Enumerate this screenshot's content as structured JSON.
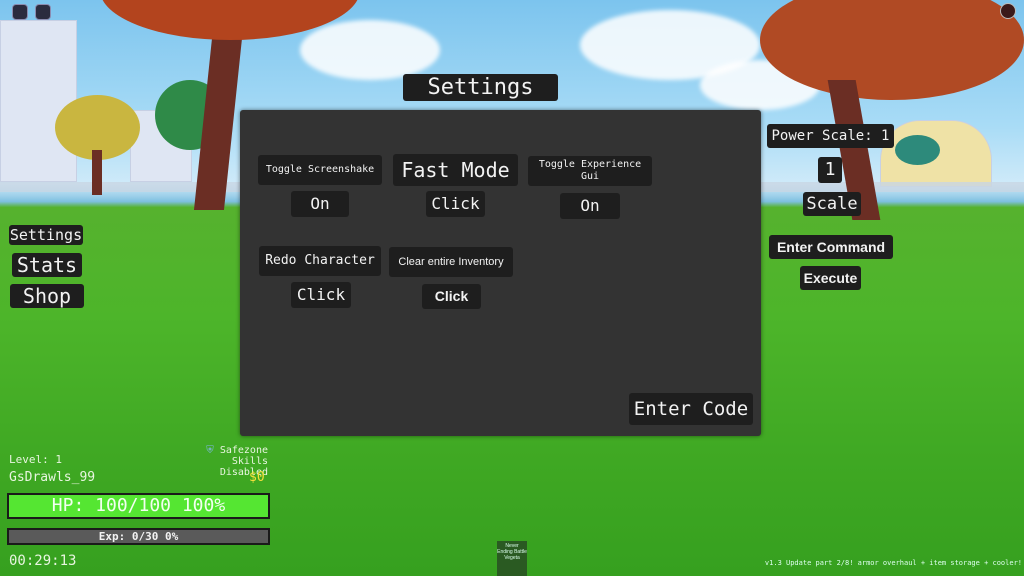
{
  "settings_title": "Settings",
  "settings_panel": {
    "toggle_screenshake": {
      "label": "Toggle Screenshake",
      "value": "On"
    },
    "fast_mode": {
      "label": "Fast Mode",
      "value": "Click"
    },
    "toggle_experience_gui": {
      "label": "Toggle Experience Gui",
      "value": "On"
    },
    "redo_character": {
      "label": "Redo Character",
      "value": "Click"
    },
    "clear_inventory": {
      "label": "Clear entire Inventory",
      "value": "Click"
    },
    "enter_code": "Enter Code"
  },
  "left_menu": {
    "settings": "Settings",
    "stats": "Stats",
    "shop": "Shop"
  },
  "right_panel": {
    "power_scale": "Power Scale: 1",
    "scale_value": "1",
    "scale_button": "Scale",
    "enter_command": "Enter Command",
    "execute": "Execute"
  },
  "hud": {
    "level": "Level: 1",
    "username": "GsDrawls_99",
    "safezone": "Safezone Skills",
    "safezone_status": "Disabled",
    "money": "$0",
    "hp_text": "HP: 100/100 100%",
    "hp_fraction": 1.0,
    "exp_text": "Exp: 0/30 0%",
    "exp_fraction": 0.0,
    "timer": "00:29:13"
  },
  "center_badge": "Never Ending Battle Vegeta",
  "version_text": "v1.3 Update part 2/8! armor overhaul + item storage + cooler!",
  "colors": {
    "hp": "#55e632",
    "money": "#f5e03a",
    "exp": "#5a5a5a"
  }
}
